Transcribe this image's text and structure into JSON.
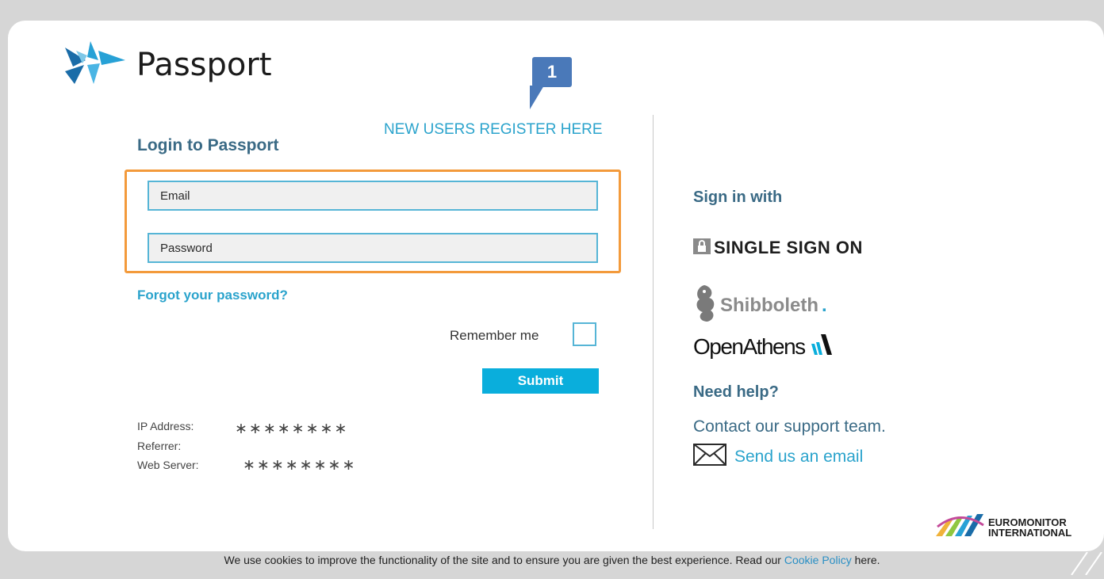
{
  "header": {
    "app_name": "Passport",
    "callout_number": "1"
  },
  "login": {
    "register_link": "NEW USERS REGISTER HERE",
    "title": "Login to Passport",
    "email_placeholder": "Email",
    "password_placeholder": "Password",
    "forgot_link": "Forgot your password?",
    "remember_label": "Remember me",
    "submit_label": "Submit"
  },
  "info": {
    "ip_label": "IP Address:",
    "ip_value": "∗∗∗∗∗∗∗∗",
    "referrer_label": "Referrer:",
    "server_label": "Web Server:",
    "server_value": "∗∗∗∗∗∗∗∗"
  },
  "sidebar": {
    "sign_in_title": "Sign in with",
    "sso_label": "SINGLE SIGN ON",
    "shibboleth_label": "Shibboleth",
    "openathens_label": "OpenAthens",
    "help_title": "Need help?",
    "contact_text": "Contact our support team.",
    "email_link": "Send us an email",
    "brand_line1": "EUROMONITOR",
    "brand_line2": "INTERNATIONAL"
  },
  "footer": {
    "cookie_text_before": "We use cookies to improve the functionality of the site and to ensure you are given the best experience. Read our",
    "cookie_link": "Cookie Policy",
    "cookie_text_after": "here."
  },
  "colors": {
    "accent": "#2aa3cc",
    "heading": "#3a6a85",
    "submit_bg": "#0aaedc",
    "highlight": "#f39a3b",
    "callout": "#4a79b9"
  }
}
